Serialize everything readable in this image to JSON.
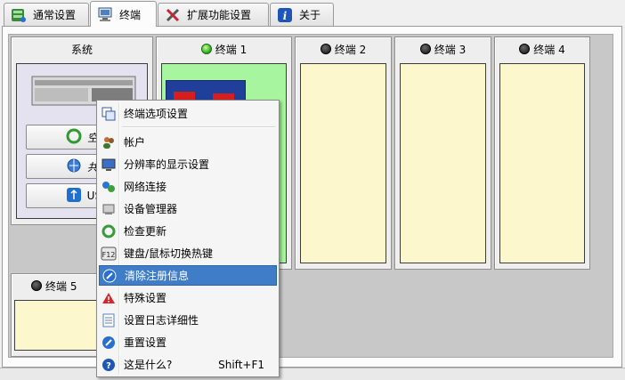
{
  "tabs": [
    {
      "label": "通常设置",
      "icon": "settings-tree-icon"
    },
    {
      "label": "终端",
      "icon": "computer-icon",
      "active": true
    },
    {
      "label": "扩展功能设置",
      "icon": "tools-icon"
    },
    {
      "label": "关于",
      "icon": "info-icon"
    }
  ],
  "system": {
    "title": "系统",
    "buttons": [
      "空闲",
      "共享",
      "USB"
    ]
  },
  "terminals": [
    {
      "label": "终端 1",
      "status": "active"
    },
    {
      "label": "终端 2",
      "status": "inactive"
    },
    {
      "label": "终端 3",
      "status": "inactive"
    },
    {
      "label": "终端 4",
      "status": "inactive"
    },
    {
      "label": "终端 5",
      "status": "inactive"
    }
  ],
  "menu": {
    "items": [
      {
        "label": "终端选项设置",
        "icon": "windows-icon"
      },
      {
        "label": "帐户",
        "icon": "users-icon"
      },
      {
        "label": "分辨率的显示设置",
        "icon": "monitor-icon"
      },
      {
        "label": "网络连接",
        "icon": "network-icon"
      },
      {
        "label": "设备管理器",
        "icon": "device-manager-icon"
      },
      {
        "label": "检查更新",
        "icon": "update-icon"
      },
      {
        "label": "键盘/鼠标切换热键",
        "icon": "f12-key-icon"
      },
      {
        "label": "清除注册信息",
        "icon": "clear-icon",
        "highlighted": true
      },
      {
        "label": "特殊设置",
        "icon": "warning-icon"
      },
      {
        "label": "设置日志详细性",
        "icon": "log-icon"
      },
      {
        "label": "重置设置",
        "icon": "reset-icon"
      },
      {
        "label": "这是什么?",
        "icon": "help-icon",
        "shortcut": "Shift+F1"
      }
    ]
  },
  "colors": {
    "terminal_bg": "#fdf7cd",
    "active_terminal_bg": "#a8f5a0",
    "highlight": "#3f7dc9"
  }
}
